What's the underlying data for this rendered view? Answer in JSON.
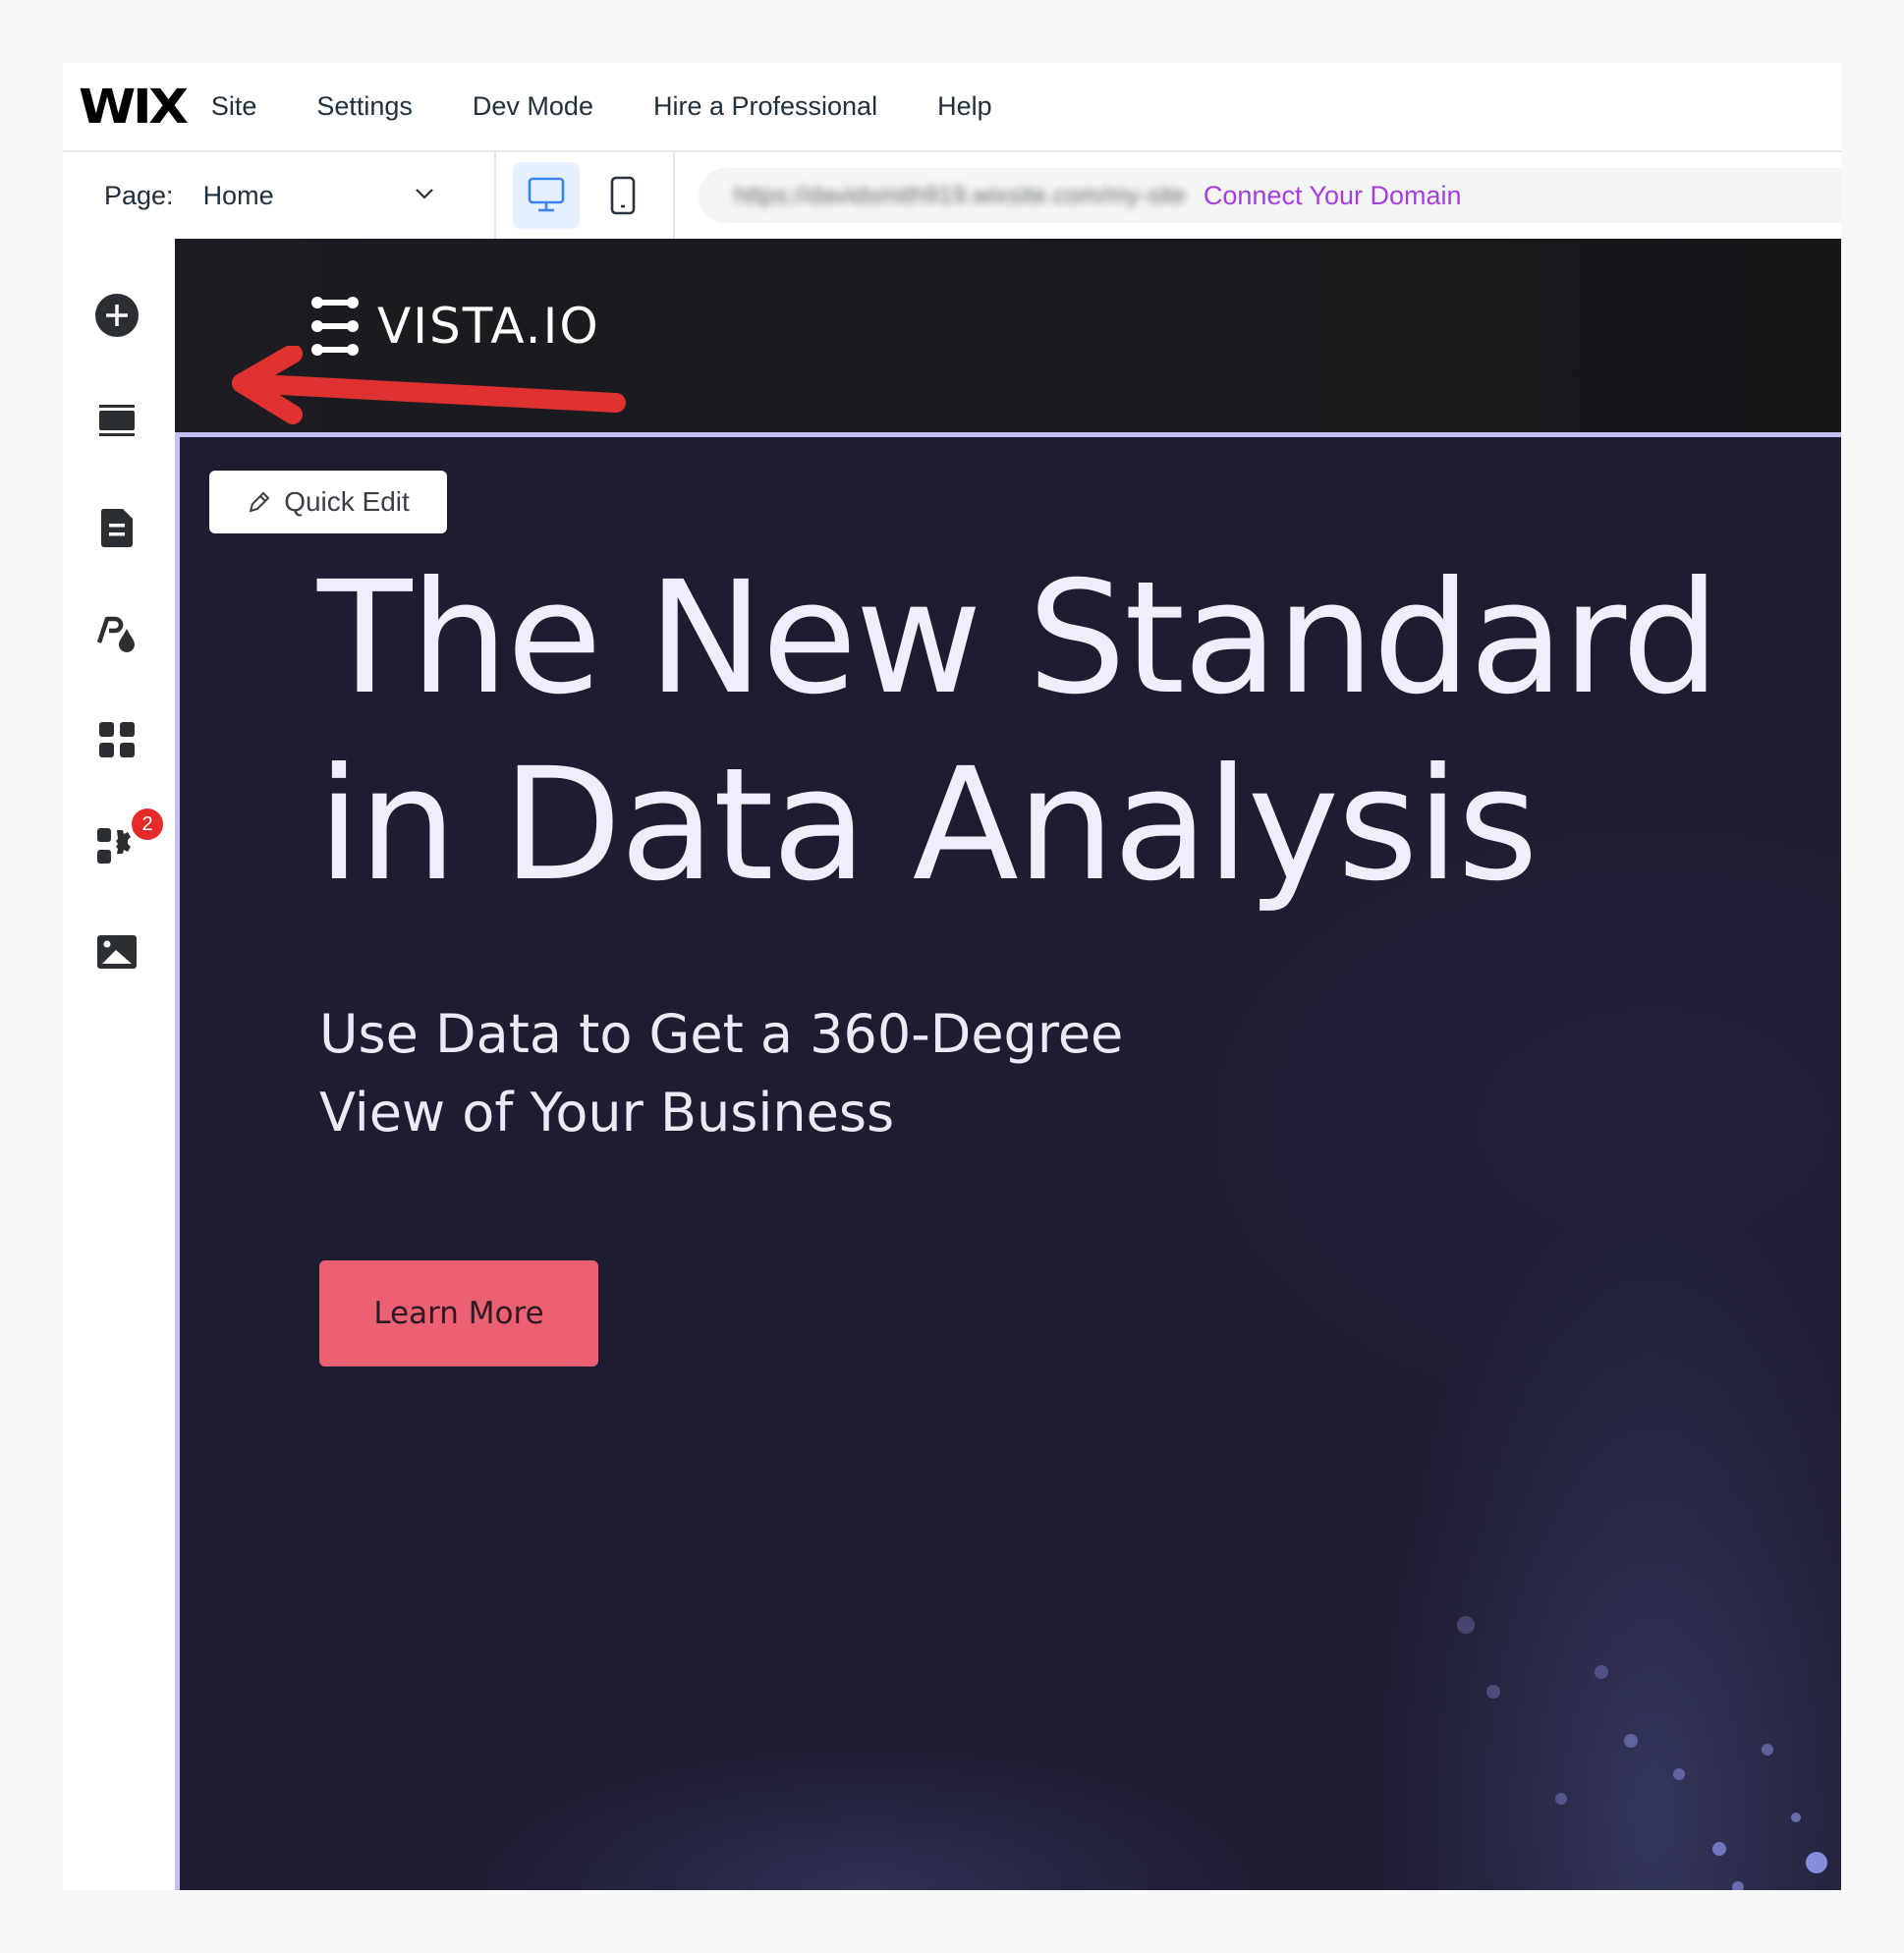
{
  "editor": {
    "logo": "WIX",
    "menu": [
      "Site",
      "Settings",
      "Dev Mode",
      "Hire a Professional",
      "Help"
    ],
    "toolbar": {
      "page_label": "Page:",
      "page_value": "Home",
      "devices": [
        {
          "name": "desktop",
          "active": true
        },
        {
          "name": "mobile",
          "active": false
        }
      ],
      "url_text": "https://davidsmith919.wixsite.com/my-site",
      "url_blurred": true,
      "connect_domain": "Connect Your Domain"
    },
    "sidebar": {
      "items": [
        {
          "name": "add-elements",
          "icon": "plus-circle-icon"
        },
        {
          "name": "sections",
          "icon": "sections-icon"
        },
        {
          "name": "pages",
          "icon": "page-icon"
        },
        {
          "name": "site-design",
          "icon": "theme-icon"
        },
        {
          "name": "add-apps",
          "icon": "apps-grid-icon"
        },
        {
          "name": "my-business",
          "icon": "apps-gear-icon",
          "badge": "2"
        },
        {
          "name": "media",
          "icon": "image-icon"
        }
      ]
    }
  },
  "site": {
    "brand": "VISTA.IO",
    "quick_edit": "Quick Edit",
    "headline_line1": "The New Standard",
    "headline_line2": "in Data Analysis",
    "subtitle_line1": "Use Data to Get a 360-Degree",
    "subtitle_line2": "View of Your Business",
    "cta": "Learn More"
  },
  "colors": {
    "accent_link": "#a43ee0",
    "device_active": "#3b82f6",
    "cta": "#ec6172",
    "badge": "#e62a2a",
    "annotation_arrow": "#e03131",
    "hero_bg": "#1e1c30",
    "selection_border": "#c3bfee"
  },
  "annotation": {
    "type": "arrow",
    "points_to": "add-elements"
  }
}
